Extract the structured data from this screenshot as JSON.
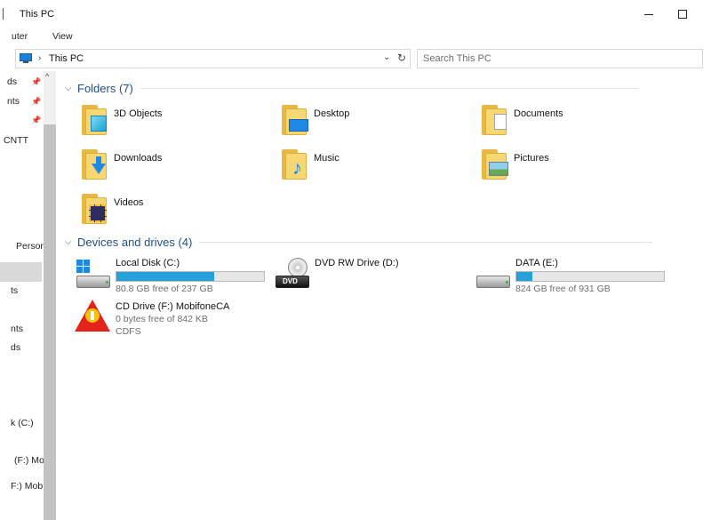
{
  "window": {
    "title": "This PC"
  },
  "ribbon": {
    "tabs": [
      "uter",
      "View"
    ]
  },
  "address": {
    "path": "This PC",
    "search_placeholder": "Search This PC"
  },
  "nav": {
    "items": [
      "ds",
      "nts",
      "",
      "CNTT",
      "Person",
      "",
      "ts",
      "nts",
      "ds",
      "k (C:)",
      "(F:) Mo",
      "F:) Mob"
    ]
  },
  "folders": {
    "header": "Folders (7)",
    "items": [
      {
        "label": "3D Objects",
        "icon": "3d-objects-folder-icon"
      },
      {
        "label": "Desktop",
        "icon": "desktop-folder-icon"
      },
      {
        "label": "Documents",
        "icon": "documents-folder-icon"
      },
      {
        "label": "Downloads",
        "icon": "downloads-folder-icon"
      },
      {
        "label": "Music",
        "icon": "music-folder-icon"
      },
      {
        "label": "Pictures",
        "icon": "pictures-folder-icon"
      },
      {
        "label": "Videos",
        "icon": "videos-folder-icon"
      }
    ]
  },
  "devices": {
    "header": "Devices and drives (4)",
    "items": [
      {
        "name": "Local Disk (C:)",
        "free": "80.8 GB free of 237 GB",
        "used_fraction": 0.66,
        "icon": "windows-drive-icon"
      },
      {
        "name": "DVD RW Drive (D:)",
        "icon": "dvd-drive-icon"
      },
      {
        "name": "DATA (E:)",
        "free": "824 GB free of 931 GB",
        "used_fraction": 0.11,
        "icon": "hard-drive-icon"
      },
      {
        "name": "CD Drive (F:) MobifoneCA",
        "free": "0 bytes free of 842 KB",
        "filesystem": "CDFS",
        "icon": "mobifoneca-cd-icon"
      }
    ]
  },
  "colors": {
    "accent": "#26a0da",
    "header_text": "#1f4e8c"
  }
}
